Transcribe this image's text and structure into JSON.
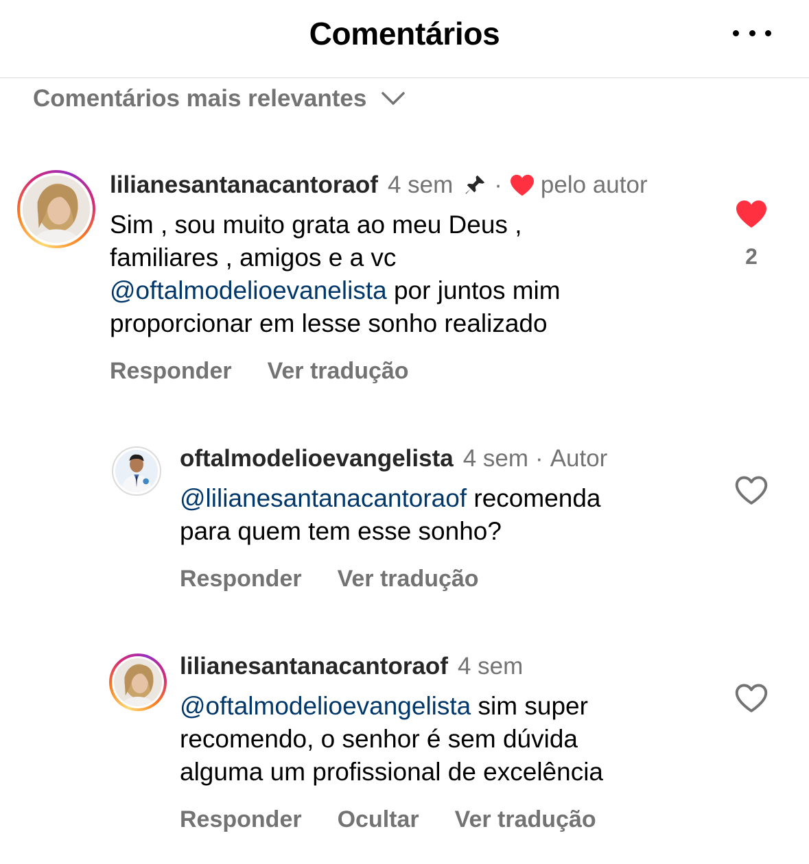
{
  "header": {
    "title": "Comentários"
  },
  "sort": {
    "label": "Comentários mais relevantes"
  },
  "comments": [
    {
      "username": "lilianesantanacantoraof",
      "time": "4 sem",
      "separator": "·",
      "liked_by_author_label": "pelo autor",
      "body_lines": [
        "Sim , sou muito grata ao meu Deus ,",
        "familiares , amigos e a vc"
      ],
      "mention": "@oftalmodelioevanelista",
      "body_after_mention": " por juntos mim",
      "body_last_line": "proporcionar em lesse sonho realizado",
      "like_count": "2",
      "actions": {
        "reply": "Responder",
        "translate": "Ver tradução"
      }
    },
    {
      "username": "oftalmodelioevangelista",
      "time": "4 sem",
      "separator": "·",
      "badge": "Autor",
      "mention": "@lilianesantanacantoraof",
      "body_after_mention": " recomenda",
      "body_last_line": "para quem tem esse sonho?",
      "actions": {
        "reply": "Responder",
        "translate": "Ver tradução"
      }
    },
    {
      "username": "lilianesantanacantoraof",
      "time": "4 sem",
      "mention": "@oftalmodelioevangelista",
      "body_after_mention": " sim super",
      "body_lines": [
        "recomendo, o senhor é sem dúvida",
        "alguma um profissional de excelência"
      ],
      "actions": {
        "reply": "Responder",
        "hide": "Ocultar",
        "translate": "Ver tradução"
      }
    }
  ],
  "colors": {
    "mention": "#00376b",
    "like_red": "#ff3040",
    "secondary": "#737373"
  },
  "icons": [
    "more-options-icon",
    "chevron-down-icon",
    "pin-icon",
    "heart-filled-icon",
    "heart-outline-icon"
  ]
}
